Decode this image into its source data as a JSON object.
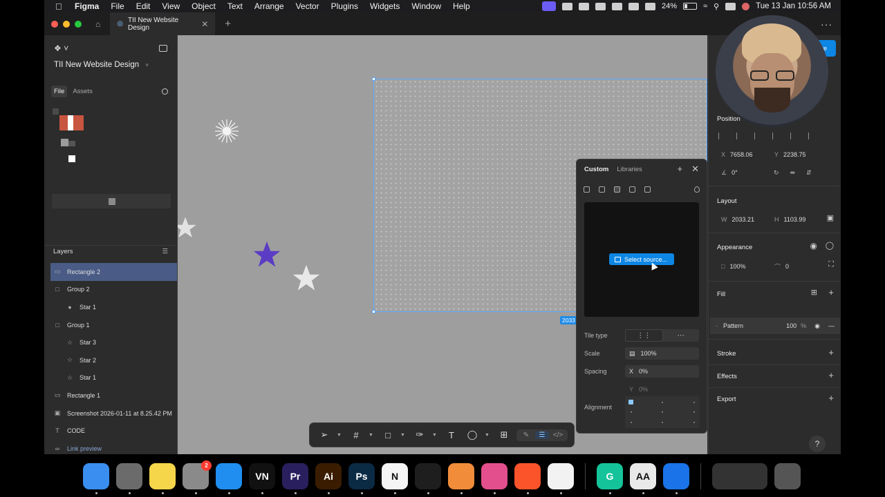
{
  "menubar": {
    "app": "Figma",
    "items": [
      "File",
      "Edit",
      "View",
      "Object",
      "Text",
      "Arrange",
      "Vector",
      "Plugins",
      "Widgets",
      "Window",
      "Help"
    ],
    "battery": "24%",
    "clock": "Tue 13 Jan  10:56 AM"
  },
  "tabbar": {
    "doc_tab": "TII New Website Design"
  },
  "left_panel": {
    "file_name": "TII New Website Design",
    "tabs": {
      "file": "File",
      "assets": "Assets"
    },
    "layers_title": "Layers",
    "layers": [
      {
        "name": "Rectangle 2",
        "icon": "rect",
        "indent": 0,
        "selected": true
      },
      {
        "name": "Group 2",
        "icon": "frame",
        "indent": 0
      },
      {
        "name": "Star 1",
        "icon": "dot",
        "indent": 1
      },
      {
        "name": "Group 1",
        "icon": "frame",
        "indent": 0
      },
      {
        "name": "Star 3",
        "icon": "star",
        "indent": 1
      },
      {
        "name": "Star 2",
        "icon": "star",
        "indent": 1
      },
      {
        "name": "Star 1",
        "icon": "star",
        "indent": 1
      },
      {
        "name": "Rectangle 1",
        "icon": "rect",
        "indent": 0
      },
      {
        "name": "Screenshot 2026-01-11 at 8.25.42 PM",
        "icon": "image",
        "indent": 0
      },
      {
        "name": "CODE",
        "icon": "text",
        "indent": 0
      },
      {
        "name": "Link preview",
        "icon": "link",
        "indent": 0
      }
    ]
  },
  "canvas": {
    "dimension_badge": "2033"
  },
  "pattern_popup": {
    "tabs": {
      "custom": "Custom",
      "libraries": "Libraries"
    },
    "select_source": "Select source...",
    "tile_type_label": "Tile type",
    "scale_label": "Scale",
    "scale_value": "100%",
    "spacing_label": "Spacing",
    "spacing_x_key": "X",
    "spacing_x": "0%",
    "spacing_y_key": "Y",
    "spacing_y": "0%",
    "alignment_label": "Alignment"
  },
  "right_panel": {
    "share_label": "re",
    "position_title": "Position",
    "x_key": "X",
    "x_value": "7658.06",
    "y_key": "Y",
    "y_value": "2238.75",
    "rotation": "0°",
    "layout_title": "Layout",
    "w_key": "W",
    "w_value": "2033.21",
    "h_key": "H",
    "h_value": "1103.99",
    "appearance_title": "Appearance",
    "opacity": "100%",
    "radius": "0",
    "fill_title": "Fill",
    "fill_name": "Pattern",
    "fill_opacity": "100",
    "fill_pct": "%",
    "stroke_title": "Stroke",
    "effects_title": "Effects",
    "export_title": "Export",
    "help": "?"
  },
  "toolbar": {
    "tools": [
      "move-tool",
      "frame-tool",
      "shape-tool",
      "pen-tool",
      "text-tool",
      "comment-tool",
      "actions-tool"
    ]
  },
  "dock": {
    "apps": [
      {
        "name": "Finder",
        "label": "",
        "color": "#3a8ef0"
      },
      {
        "name": "Launchpad",
        "label": "",
        "color": "#6b6b6b"
      },
      {
        "name": "Notes",
        "label": "",
        "color": "#f5d54a"
      },
      {
        "name": "System Settings",
        "label": "",
        "color": "#8a8a8a",
        "badge": "2"
      },
      {
        "name": "Safari",
        "label": "",
        "color": "#1f8ef0"
      },
      {
        "name": "VN",
        "label": "VN",
        "color": "#111111"
      },
      {
        "name": "Premiere Pro",
        "label": "Pr",
        "color": "#2a1f5e"
      },
      {
        "name": "Illustrator",
        "label": "Ai",
        "color": "#3a1d00"
      },
      {
        "name": "Photoshop",
        "label": "Ps",
        "color": "#0b2a44"
      },
      {
        "name": "Notion",
        "label": "N",
        "color": "#f5f5f5"
      },
      {
        "name": "Figma",
        "label": "",
        "color": "#1e1e1e"
      },
      {
        "name": "Arc",
        "label": "",
        "color": "#f08c3a"
      },
      {
        "name": "Affinity",
        "label": "",
        "color": "#e34f8c"
      },
      {
        "name": "Brave",
        "label": "",
        "color": "#fb542b"
      },
      {
        "name": "Slack",
        "label": "",
        "color": "#f2f2f2"
      },
      {
        "name": "Grammarly",
        "label": "G",
        "color": "#15c39a"
      },
      {
        "name": "Font Book",
        "label": "AA",
        "color": "#e9e9e9"
      },
      {
        "name": "Perplexity",
        "label": "",
        "color": "#1a73e8"
      }
    ]
  },
  "colors": {
    "accent": "#0d86e4",
    "selection": "#5aa8ff",
    "star_purple": "#5b3cc4"
  }
}
